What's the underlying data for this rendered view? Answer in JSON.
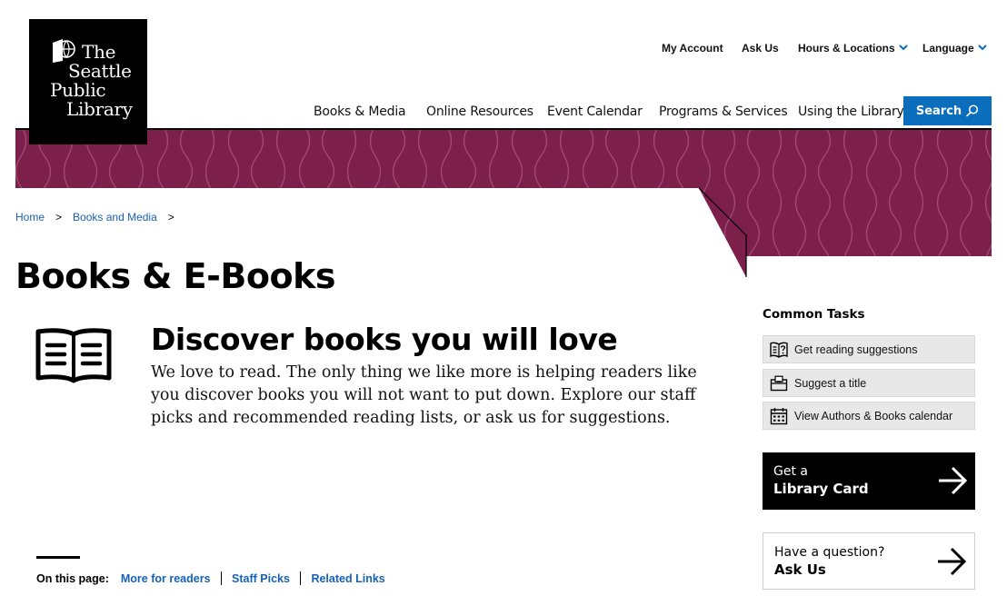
{
  "logo": {
    "lines": [
      "The",
      "Seattle",
      "Public",
      "Library"
    ]
  },
  "utility_nav": [
    {
      "label": "My Account",
      "dropdown": false
    },
    {
      "label": "Ask Us",
      "dropdown": false
    },
    {
      "label": "Hours & Locations",
      "dropdown": true
    },
    {
      "label": "Language",
      "dropdown": true
    }
  ],
  "main_nav": [
    "Books & Media",
    "Online Resources",
    "Event Calendar",
    "Programs & Services",
    "Using the Library"
  ],
  "search": {
    "label": "Search"
  },
  "breadcrumb": [
    "Home",
    "Books and Media"
  ],
  "page_title": "Books & E-Books",
  "intro": {
    "heading": "Discover books you will love",
    "text": "We love to read. The only thing we like more is helping readers like you discover books you will not want to put down. Explore our staff picks and recommended reading lists, or ask us for suggestions."
  },
  "on_this_page": {
    "label": "On this page:",
    "links": [
      "More for readers",
      "Staff Picks",
      "Related Links"
    ]
  },
  "common_tasks": {
    "title": "Common Tasks",
    "items": [
      {
        "label": "Get reading suggestions",
        "icon": "book-question-icon"
      },
      {
        "label": "Suggest a title",
        "icon": "suggestion-box-icon"
      },
      {
        "label": "View Authors & Books calendar",
        "icon": "calendar-icon"
      }
    ]
  },
  "library_card": {
    "line1": "Get a",
    "line2": "Library Card"
  },
  "ask_us": {
    "line1": "Have a question?",
    "line2": "Ask Us"
  },
  "colors": {
    "banner": "#7c1f4b",
    "accent_blue": "#0a6ebd",
    "link": "#1660b8"
  }
}
